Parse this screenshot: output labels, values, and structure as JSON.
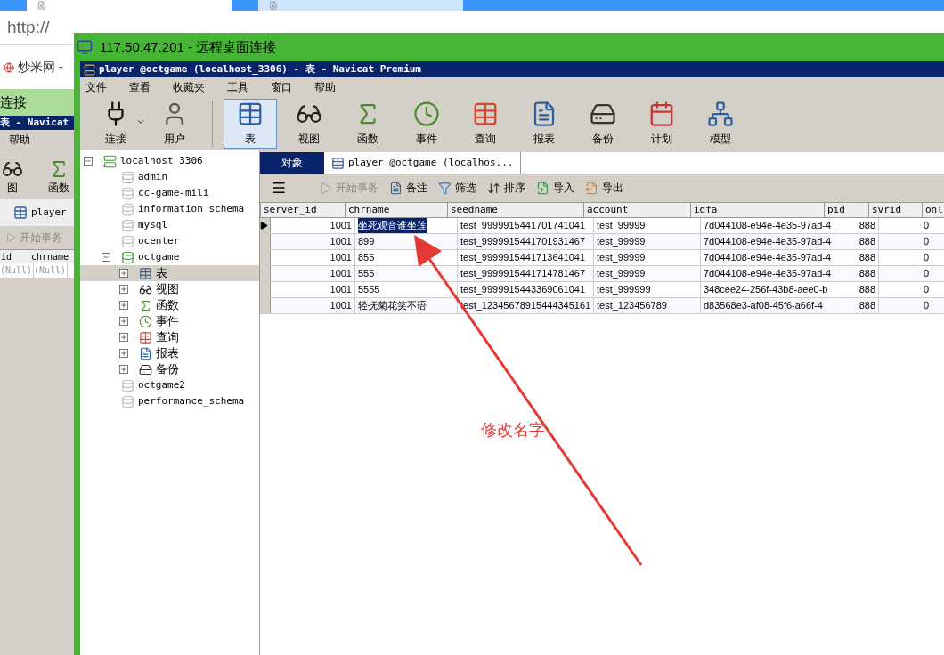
{
  "browser": {
    "tabs": [
      {
        "selected": true
      },
      {
        "selected": false
      }
    ],
    "url": "http://",
    "bookmark": "炒米网 -"
  },
  "background_window": {
    "title": "连接",
    "app_title": "表 - Navicat",
    "menu": "帮助",
    "tools": [
      "图",
      "函数"
    ],
    "tab": "player",
    "action": "开始事务",
    "columns": [
      "id",
      "chrname"
    ],
    "cells": [
      "(Null)",
      "(Null)"
    ]
  },
  "remote_window": {
    "title": "117.50.47.201 - 远程桌面连接"
  },
  "navicat": {
    "title": "player @octgame (localhost_3306) - 表 - Navicat Premium",
    "menu": [
      "文件",
      "查看",
      "收藏夹",
      "工具",
      "窗口",
      "帮助"
    ],
    "toolbar": [
      {
        "label": "连接",
        "kind": "connect",
        "selected": false
      },
      {
        "label": "用户",
        "kind": "user",
        "selected": false
      },
      {
        "label": "表",
        "kind": "table",
        "selected": true
      },
      {
        "label": "视图",
        "kind": "view",
        "selected": false
      },
      {
        "label": "函数",
        "kind": "function",
        "selected": false
      },
      {
        "label": "事件",
        "kind": "event",
        "selected": false
      },
      {
        "label": "查询",
        "kind": "query",
        "selected": false
      },
      {
        "label": "报表",
        "kind": "report",
        "selected": false
      },
      {
        "label": "备份",
        "kind": "backup",
        "selected": false
      },
      {
        "label": "计划",
        "kind": "schedule",
        "selected": false
      },
      {
        "label": "模型",
        "kind": "model",
        "selected": false
      }
    ],
    "tree": [
      {
        "label": "localhost_3306",
        "kind": "server",
        "expanded": true,
        "selected": false,
        "children": [
          {
            "label": "admin",
            "kind": "database",
            "selected": false
          },
          {
            "label": "cc-game-mili",
            "kind": "database",
            "selected": false
          },
          {
            "label": "information_schema",
            "kind": "database",
            "selected": false
          },
          {
            "label": "mysql",
            "kind": "database",
            "selected": false
          },
          {
            "label": "ocenter",
            "kind": "database",
            "selected": false
          },
          {
            "label": "octgame",
            "kind": "open-database",
            "expanded": true,
            "selected": false,
            "children": [
              {
                "label": "表",
                "kind": "table",
                "expanded": false,
                "selected": true
              },
              {
                "label": "视图",
                "kind": "view",
                "expanded": false,
                "selected": false
              },
              {
                "label": "函数",
                "kind": "function",
                "expanded": false,
                "selected": false
              },
              {
                "label": "事件",
                "kind": "event",
                "expanded": false,
                "selected": false
              },
              {
                "label": "查询",
                "kind": "query",
                "expanded": false,
                "selected": false
              },
              {
                "label": "报表",
                "kind": "report",
                "expanded": false,
                "selected": false
              },
              {
                "label": "备份",
                "kind": "backup",
                "expanded": false,
                "selected": false
              }
            ]
          },
          {
            "label": "octgame2",
            "kind": "database",
            "selected": false
          },
          {
            "label": "performance_schema",
            "kind": "database",
            "selected": false
          }
        ]
      }
    ],
    "tabs": [
      {
        "label": "对象",
        "selected": false
      },
      {
        "label": "player @octgame (localhos...",
        "selected": true
      }
    ],
    "actions": [
      {
        "label": "开始事务",
        "kind": "transaction",
        "disabled": true
      },
      {
        "label": "备注",
        "kind": "note",
        "disabled": false
      },
      {
        "label": "筛选",
        "kind": "filter",
        "disabled": false
      },
      {
        "label": "排序",
        "kind": "sort",
        "disabled": false
      },
      {
        "label": "导入",
        "kind": "import",
        "disabled": false
      },
      {
        "label": "导出",
        "kind": "export",
        "disabled": false
      }
    ],
    "table": {
      "columns": [
        "server_id",
        "chrname",
        "seedname",
        "account",
        "idfa",
        "pid",
        "svrid",
        "onl"
      ],
      "rows": [
        {
          "selected": true,
          "cells": [
            "1001",
            "坐死观音谁坐莲",
            "test_9999915441701741041",
            "test_99999",
            "7d044108-e94e-4e35-97ad-4",
            "888",
            "0",
            ""
          ]
        },
        {
          "selected": false,
          "cells": [
            "1001",
            "899",
            "test_9999915441701931467",
            "test_99999",
            "7d044108-e94e-4e35-97ad-4",
            "888",
            "0",
            ""
          ]
        },
        {
          "selected": false,
          "cells": [
            "1001",
            "855",
            "test_9999915441713641041",
            "test_99999",
            "7d044108-e94e-4e35-97ad-4",
            "888",
            "0",
            ""
          ]
        },
        {
          "selected": false,
          "cells": [
            "1001",
            "555",
            "test_9999915441714781467",
            "test_99999",
            "7d044108-e94e-4e35-97ad-4",
            "888",
            "0",
            ""
          ]
        },
        {
          "selected": false,
          "cells": [
            "1001",
            "5555",
            "test_9999915443369061041",
            "test_999999",
            "348cee24-256f-43b8-aee0-b",
            "888",
            "0",
            ""
          ]
        },
        {
          "selected": false,
          "cells": [
            "1001",
            "轻抚菊花笑不语",
            "test_12345678915444345161",
            "test_123456789",
            "d83568e3-af08-45f6-a66f-4",
            "888",
            "0",
            ""
          ]
        }
      ]
    },
    "annotation": {
      "text": "修改名字"
    }
  }
}
